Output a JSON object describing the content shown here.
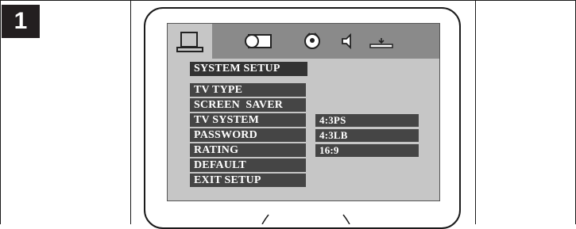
{
  "step": {
    "number": "1"
  },
  "menu": {
    "icons": [
      {
        "name": "system-setup-icon",
        "active": true
      },
      {
        "name": "language-setup-icon",
        "active": false
      },
      {
        "name": "video-setup-icon",
        "active": false
      },
      {
        "name": "audio-setup-icon",
        "active": false
      },
      {
        "name": "speaker-setup-icon",
        "active": false
      }
    ],
    "title": "SYSTEM SETUP",
    "items": [
      "TV TYPE",
      "SCREEN  SAVER",
      "TV SYSTEM",
      "PASSWORD",
      "RATING",
      "DEFAULT",
      "EXIT SETUP"
    ],
    "options": [
      "4:3PS",
      "4:3LB",
      "16:9"
    ]
  }
}
